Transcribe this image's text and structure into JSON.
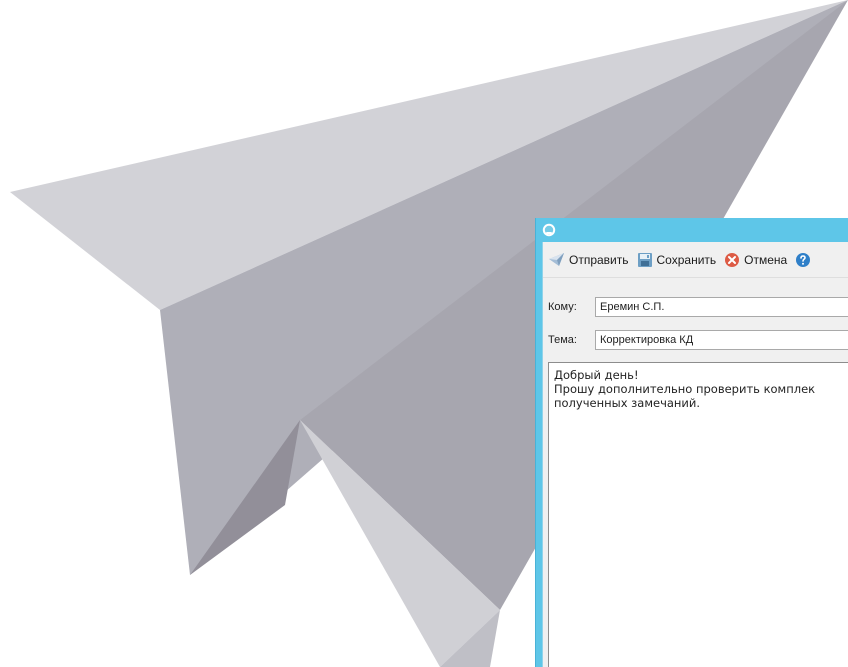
{
  "toolbar": {
    "send_label": "Отправить",
    "save_label": "Сохранить",
    "cancel_label": "Отмена"
  },
  "form": {
    "to_label": "Кому:",
    "to_value": "Еремин С.П.",
    "subject_label": "Тема:",
    "subject_value": "Корректировка КД"
  },
  "body": {
    "lines": [
      "Добрый день!",
      "Прошу дополнительно проверить комплек",
      "полученных замечаний."
    ]
  },
  "icons": {
    "app": "app-icon",
    "send": "paper-plane-icon",
    "save": "floppy-disk-icon",
    "cancel": "cancel-icon",
    "help": "help-icon",
    "illustration": "paper-plane-icon"
  },
  "colors": {
    "titlebar": "#5ec6e8",
    "plane_light": "#cfcfd4",
    "plane_mid": "#aeaeb7",
    "plane_dark": "#95919b"
  }
}
